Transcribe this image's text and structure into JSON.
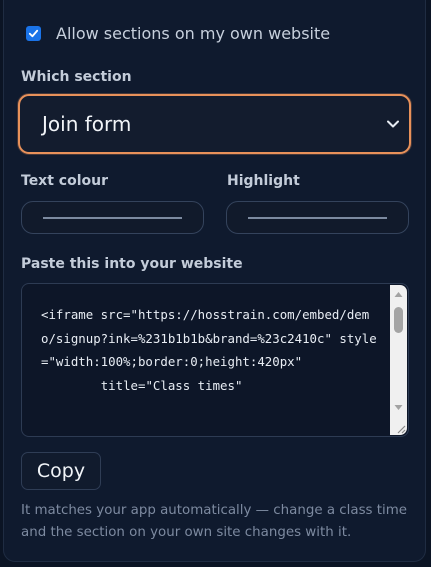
{
  "allow": {
    "label": "Allow sections on my own website",
    "checked": true
  },
  "section": {
    "label": "Which section",
    "value": "Join form"
  },
  "colors": {
    "text_label": "Text colour",
    "highlight_label": "Highlight"
  },
  "embed": {
    "label": "Paste this into your website",
    "code": "<iframe src=\"https://hosstrain.com/embed/demo/signup?ink=%231b1b1b&brand=%23c2410c\" style=\"width:100%;border:0;height:420px\"\n        title=\"Class times\""
  },
  "copy_label": "Copy",
  "hint": "It matches your app automatically — change a class time and the section on your own site changes with it.",
  "accent": {
    "focus": "#e8915a",
    "checkbox": "#1a73e8"
  }
}
